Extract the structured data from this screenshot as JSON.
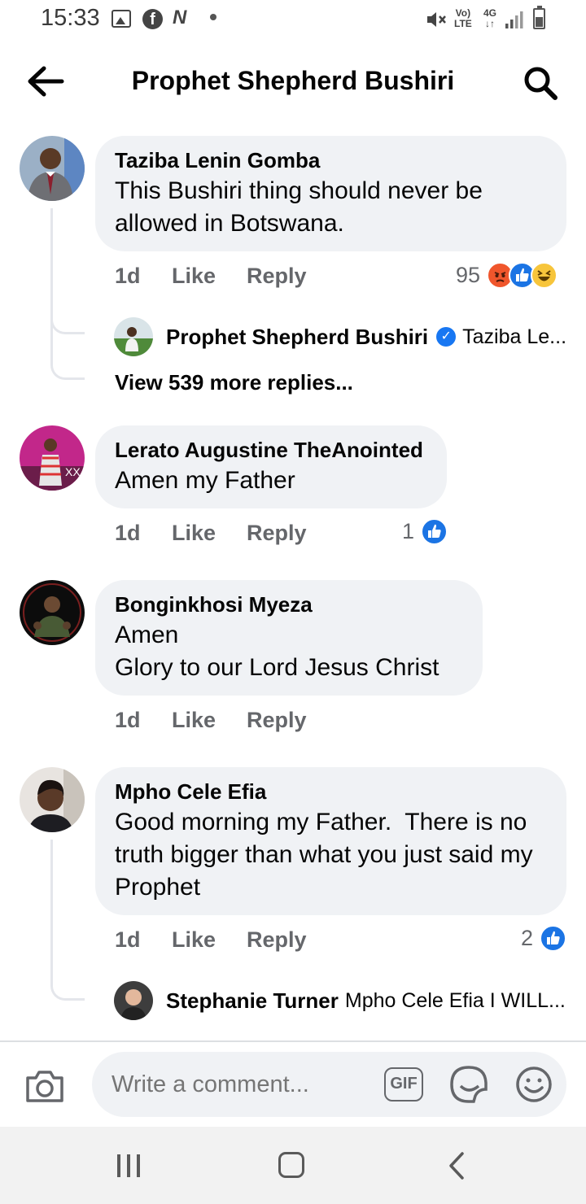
{
  "status_bar": {
    "time": "15:33",
    "volte_top": "Vo)",
    "volte_bottom": "LTE",
    "network": "4G",
    "network_arrows": "↓↑"
  },
  "header": {
    "title": "Prophet Shepherd Bushiri"
  },
  "comments": [
    {
      "author": "Taziba Lenin Gomba",
      "text": "This Bushiri thing should never be allowed in Botswana.",
      "time": "1d",
      "like_label": "Like",
      "reply_label": "Reply",
      "reaction_count": "95",
      "reactions": [
        "angry",
        "like",
        "haha"
      ],
      "replies_preview": {
        "author": "Prophet Shepherd Bushiri",
        "verified": true,
        "text": "Taziba Le..."
      },
      "view_more": "View 539 more replies..."
    },
    {
      "author": "Lerato Augustine TheAnointed",
      "text": "Amen my Father",
      "time": "1d",
      "like_label": "Like",
      "reply_label": "Reply",
      "reaction_count": "1",
      "reactions": [
        "like"
      ]
    },
    {
      "author": "Bonginkhosi Myeza",
      "text_line1": "Amen",
      "text_line2": "Glory to our Lord Jesus Christ",
      "time": "1d",
      "like_label": "Like",
      "reply_label": "Reply"
    },
    {
      "author": "Mpho Cele Efia",
      "text": "Good morning my Father.  There is no truth bigger than what you just said my Prophet",
      "time": "1d",
      "like_label": "Like",
      "reply_label": "Reply",
      "reaction_count": "2",
      "reactions": [
        "like"
      ],
      "replies_preview": {
        "author": "Stephanie Turner",
        "text": "Mpho Cele Efia I WILL..."
      }
    }
  ],
  "composer": {
    "placeholder": "Write a comment...",
    "gif_label": "GIF"
  },
  "colors": {
    "bubble": "#f0f2f5",
    "like_blue": "#1b74e4",
    "angry": "#f0562c",
    "haha": "#f7c53b",
    "meta_gray": "#65676b"
  }
}
